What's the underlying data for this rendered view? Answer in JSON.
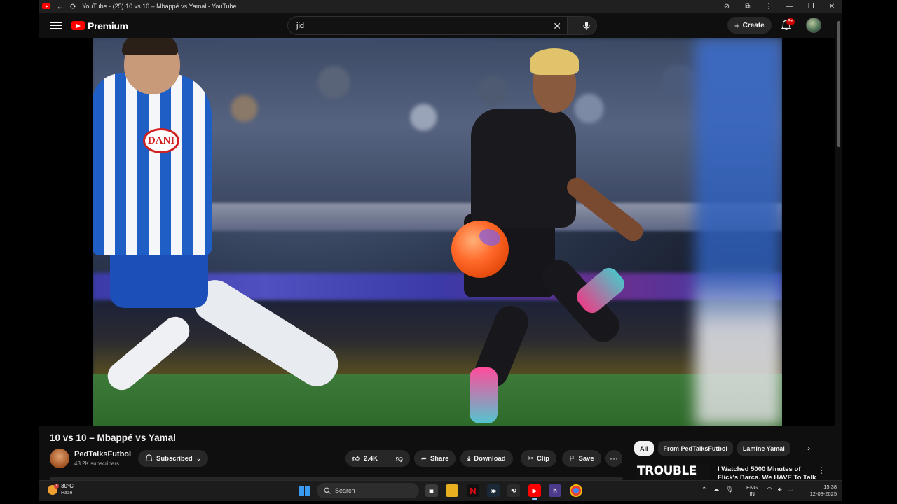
{
  "browser": {
    "tab_title": "YouTube - (25) 10 vs 10 – Mbappé vs Yamal - YouTube"
  },
  "header": {
    "logo_text": "Premium",
    "search_value": "jid",
    "create_label": "Create",
    "notification_count": "9+"
  },
  "video": {
    "title": "10 vs 10 – Mbappé vs Yamal",
    "sponsor_text": "DANI",
    "channel": {
      "name": "PedTalksFutbol",
      "subscribers": "43.2K subscribers",
      "subscribe_state": "Subscribed"
    },
    "actions": {
      "likes": "2.4K",
      "share": "Share",
      "download": "Download",
      "clip": "Clip",
      "save": "Save"
    }
  },
  "sidebar": {
    "chips": [
      "All",
      "From PedTalksFutbol",
      "Lamine Yamal"
    ],
    "recommendation": {
      "thumb_text": "TROUBLE",
      "title": "I Watched 5000 Minutes of Flick's Barca. We HAVE To Talk"
    }
  },
  "taskbar": {
    "weather_temp": "30°C",
    "weather_desc": "Haze",
    "weather_badge": "1",
    "search_placeholder": "Search",
    "lang_line1": "ENG",
    "lang_line2": "IN",
    "time": "15:38",
    "date": "12-08-2025"
  },
  "colors": {
    "youtube_red": "#ff0000",
    "background": "#0f0f0f",
    "pill": "#272727"
  }
}
